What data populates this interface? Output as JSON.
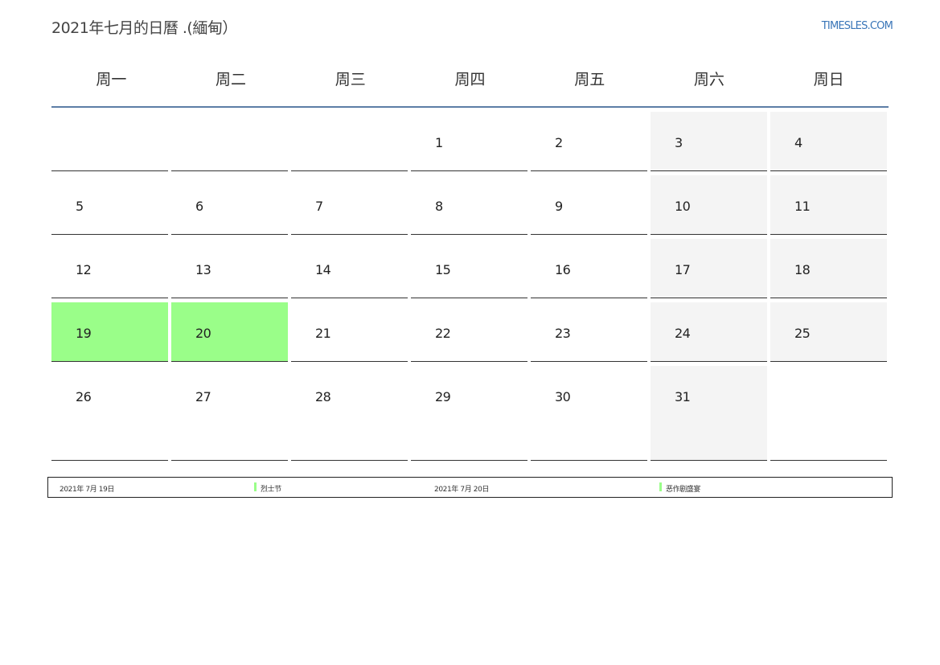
{
  "header": {
    "title": "2021年七月的日曆 .(緬甸）",
    "brand": "TIMESLES.COM"
  },
  "weekdays": [
    "周一",
    "周二",
    "周三",
    "周四",
    "周五",
    "周六",
    "周日"
  ],
  "weeks": [
    [
      "",
      "",
      "",
      "1",
      "2",
      "3",
      "4"
    ],
    [
      "5",
      "6",
      "7",
      "8",
      "9",
      "10",
      "11"
    ],
    [
      "12",
      "13",
      "14",
      "15",
      "16",
      "17",
      "18"
    ],
    [
      "19",
      "20",
      "21",
      "22",
      "23",
      "24",
      "25"
    ],
    [
      "26",
      "27",
      "28",
      "29",
      "30",
      "31",
      ""
    ]
  ],
  "weekend_shading": [
    [
      false,
      false,
      false,
      false,
      false,
      true,
      true
    ],
    [
      false,
      false,
      false,
      false,
      false,
      true,
      true
    ],
    [
      false,
      false,
      false,
      false,
      false,
      true,
      true
    ],
    [
      false,
      false,
      false,
      false,
      false,
      true,
      true
    ],
    [
      false,
      false,
      false,
      false,
      false,
      true,
      false
    ]
  ],
  "holiday_cells": [
    "19",
    "20"
  ],
  "holiday_color": "#9afe89",
  "weekend_color": "#f4f4f4",
  "accent_color": "#5d7ea6",
  "holidays": [
    {
      "date": "2021年 7月 19日",
      "name": "烈士节"
    },
    {
      "date": "2021年 7月 20日",
      "name": "恶作剧盛宴"
    }
  ]
}
